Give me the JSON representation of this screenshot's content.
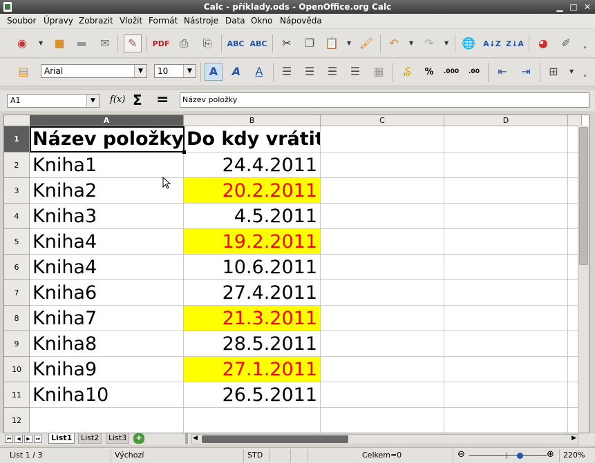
{
  "window": {
    "title": "Calc - příklady.ods - OpenOffice.org Calc"
  },
  "menubar": {
    "items": [
      "Soubor",
      "Úpravy",
      "Zobrazit",
      "Vložit",
      "Formát",
      "Nástroje",
      "Data",
      "Okno",
      "Nápověda"
    ]
  },
  "format_toolbar": {
    "font_name": "Arial",
    "font_size": "10"
  },
  "formula_bar": {
    "cell_ref": "A1",
    "content": "Název položky",
    "function_wizard": "f(x)",
    "sum": "Σ",
    "equals": "="
  },
  "sheet": {
    "columns": [
      "A",
      "B",
      "C",
      "D"
    ],
    "rows": [
      "1",
      "2",
      "3",
      "4",
      "5",
      "6",
      "7",
      "8",
      "9",
      "10",
      "11",
      "12"
    ],
    "cells": [
      {
        "a": "Název položky",
        "b": "Do kdy vrátit",
        "highlight": false
      },
      {
        "a": "Kniha1",
        "b": "24.4.2011",
        "highlight": false
      },
      {
        "a": "Kniha2",
        "b": "20.2.2011",
        "highlight": true
      },
      {
        "a": "Kniha3",
        "b": "4.5.2011",
        "highlight": false
      },
      {
        "a": "Kniha4",
        "b": "19.2.2011",
        "highlight": true
      },
      {
        "a": "Kniha4",
        "b": "10.6.2011",
        "highlight": false
      },
      {
        "a": "Kniha6",
        "b": "27.4.2011",
        "highlight": false
      },
      {
        "a": "Kniha7",
        "b": "21.3.2011",
        "highlight": true
      },
      {
        "a": "Kniha8",
        "b": "28.5.2011",
        "highlight": false
      },
      {
        "a": "Kniha9",
        "b": "27.1.2011",
        "highlight": true
      },
      {
        "a": "Kniha10",
        "b": "26.5.2011",
        "highlight": false
      },
      {
        "a": "",
        "b": "",
        "highlight": false
      }
    ],
    "highlight_bg": "#ffff00",
    "highlight_fg": "#ff0000"
  },
  "tabs": {
    "items": [
      "List1",
      "List2",
      "List3"
    ],
    "active": "List1",
    "add": "+"
  },
  "statusbar": {
    "sheet": "List 1 / 3",
    "style": "Výchozí",
    "mode": "STD",
    "sum": "Celkem=0",
    "zoom": "220%"
  }
}
